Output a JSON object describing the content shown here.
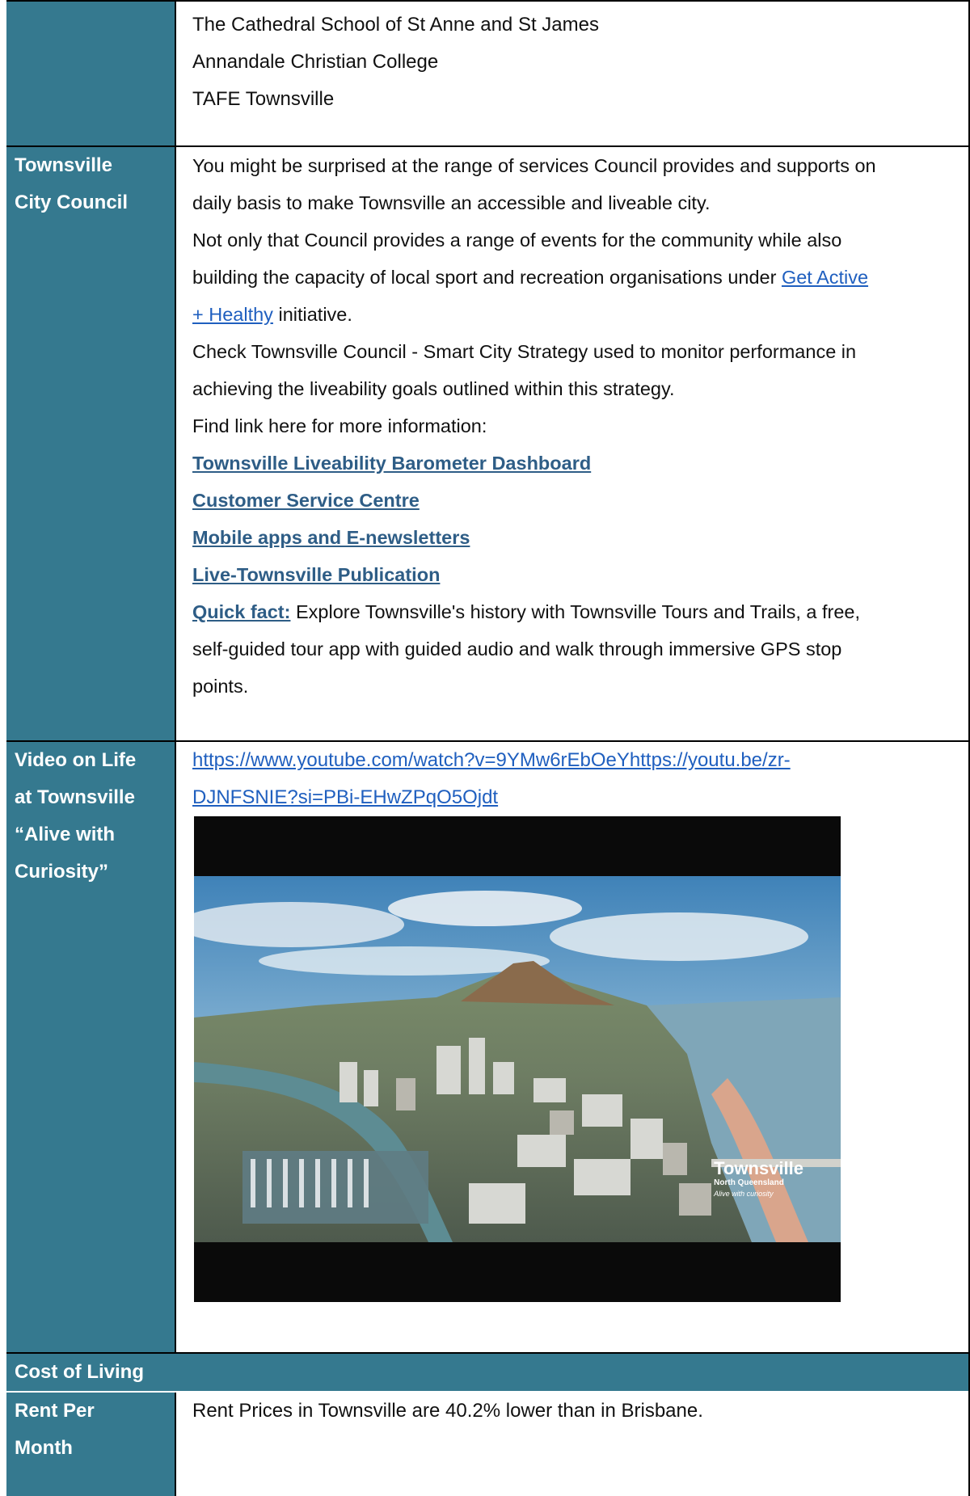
{
  "schools": {
    "lines": [
      "The Cathedral School of St Anne and St James",
      "Annandale Christian College",
      "TAFE Townsville"
    ]
  },
  "council": {
    "label_line1": "Townsville",
    "label_line2": "City Council",
    "p1_a": "You might be surprised at the range of services Council provides and supports on",
    "p1_b": "daily basis to make Townsville an accessible and liveable city.",
    "p2_a": "Not only that Council provides a range of events for the community while also",
    "p2_b": "building the capacity of local sport and recreation organisations under ",
    "p2_link_a": "Get Active",
    "p2_link_b": "+ Healthy",
    "p2_c": " initiative.",
    "p3_a": "Check Townsville Council - Smart City Strategy used to monitor performance in",
    "p3_b": "achieving the liveability goals outlined within this strategy.",
    "p4": "Find link here for more information:",
    "links": [
      "Townsville Liveability Barometer Dashboard",
      "Customer Service Centre ",
      "Mobile apps and E-newsletters",
      "Live-Townsville Publication"
    ],
    "quick_fact_label": "Quick fact:",
    "quick_fact_a": " Explore Townsville's history with Townsville Tours and Trails, a free,",
    "quick_fact_b": "self-guided tour app with guided audio and walk through immersive GPS stop",
    "quick_fact_c": "points."
  },
  "video": {
    "label_lines": [
      "Video on Life",
      "at Townsville",
      "“Alive with",
      "Curiosity”"
    ],
    "url_a": "https://www.youtube.com/watch?v=9YMw6rEbOeYhttps://youtu.be/zr-",
    "url_b": "DJNFSNIE?si=PBi-EHwZPqO5Ojdt",
    "watermark_title": "Townsville",
    "watermark_sub": "North Queensland",
    "watermark_tag": "Alive with curiosity"
  },
  "cost_of_living": {
    "header": "Cost of Living"
  },
  "rent": {
    "label_line1": "Rent Per",
    "label_line2": "Month",
    "text": "Rent Prices in Townsville are 40.2% lower than in Brisbane."
  }
}
